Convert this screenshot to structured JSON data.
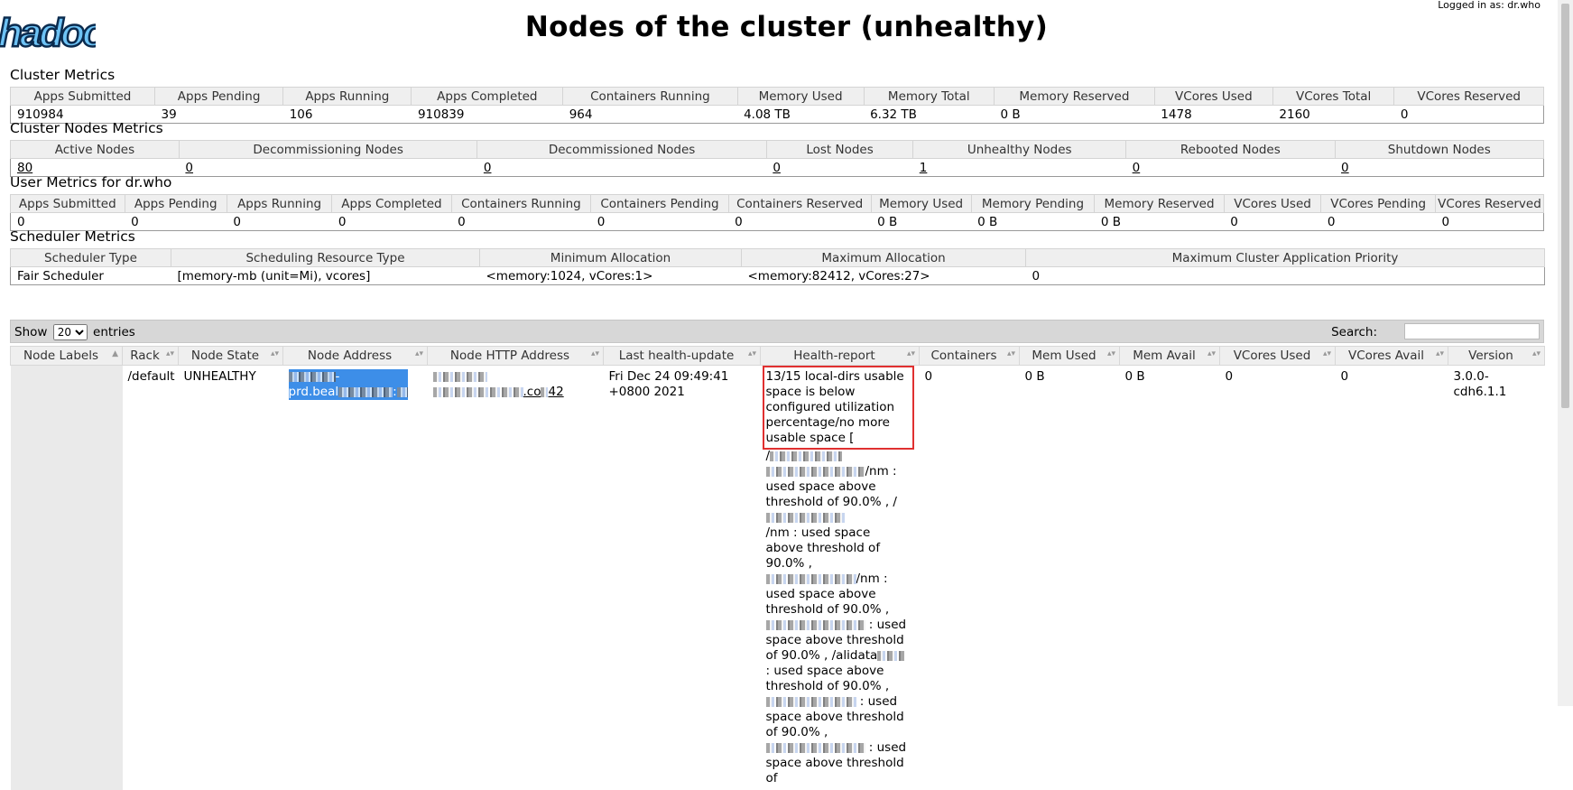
{
  "header": {
    "logo": "hadoop",
    "title": "Nodes of the cluster (unhealthy)",
    "logged_in": "Logged in as: dr.who"
  },
  "cluster_metrics": {
    "title": "Cluster Metrics",
    "headers": [
      "Apps Submitted",
      "Apps Pending",
      "Apps Running",
      "Apps Completed",
      "Containers Running",
      "Memory Used",
      "Memory Total",
      "Memory Reserved",
      "VCores Used",
      "VCores Total",
      "VCores Reserved"
    ],
    "values": [
      "910984",
      "39",
      "106",
      "910839",
      "964",
      "4.08 TB",
      "6.32 TB",
      "0 B",
      "1478",
      "2160",
      "0"
    ]
  },
  "cluster_nodes_metrics": {
    "title": "Cluster Nodes Metrics",
    "headers": [
      "Active Nodes",
      "Decommissioning Nodes",
      "Decommissioned Nodes",
      "Lost Nodes",
      "Unhealthy Nodes",
      "Rebooted Nodes",
      "Shutdown Nodes"
    ],
    "values": [
      "80",
      "0",
      "0",
      "0",
      "1",
      "0",
      "0"
    ]
  },
  "user_metrics": {
    "title": "User Metrics for dr.who",
    "headers": [
      "Apps Submitted",
      "Apps Pending",
      "Apps Running",
      "Apps Completed",
      "Containers Running",
      "Containers Pending",
      "Containers Reserved",
      "Memory Used",
      "Memory Pending",
      "Memory Reserved",
      "VCores Used",
      "VCores Pending",
      "VCores Reserved"
    ],
    "values": [
      "0",
      "0",
      "0",
      "0",
      "0",
      "0",
      "0",
      "0 B",
      "0 B",
      "0 B",
      "0",
      "0",
      "0"
    ]
  },
  "scheduler_metrics": {
    "title": "Scheduler Metrics",
    "headers": [
      "Scheduler Type",
      "Scheduling Resource Type",
      "Minimum Allocation",
      "Maximum Allocation",
      "Maximum Cluster Application Priority"
    ],
    "values": [
      "Fair Scheduler",
      "[memory-mb (unit=Mi), vcores]",
      "<memory:1024, vCores:1>",
      "<memory:82412, vCores:27>",
      "0"
    ]
  },
  "table_controls": {
    "show_label": "Show",
    "entries_option": "20",
    "entries_label": "entries",
    "search_label": "Search:",
    "search_value": ""
  },
  "nodes_table": {
    "headers": [
      "Node Labels",
      "Rack",
      "Node State",
      "Node Address",
      "Node HTTP Address",
      "Last health-update",
      "Health-report",
      "Containers",
      "Mem Used",
      "Mem Avail",
      "VCores Used",
      "VCores Avail",
      "Version"
    ],
    "row": {
      "node_labels": "",
      "rack": "/default",
      "node_state": "UNHEALTHY",
      "node_address_visible": [
        "-",
        "prd.beal",
        ":"
      ],
      "node_http_address_visible": [
        ".co",
        "42"
      ],
      "last_health_update": "Fri Dec 24 09:49:41 +0800 2021",
      "health_report_highlighted": "13/15 local-dirs usable space is below configured utilization percentage/no more usable space [",
      "health_report_rest": [
        "/",
        "/nm : used space above threshold of 90.0% , /",
        "/nm : used space above threshold of 90.0% ,",
        "/nm : used space above threshold of 90.0% ,",
        " : used space above threshold of 90.0% , /alidata",
        " : used space above threshold of 90.0% ,",
        " : used space above threshold of 90.0% ,",
        " : used space above threshold of"
      ],
      "containers": "0",
      "mem_used": "0 B",
      "mem_avail": "0 B",
      "vcores_used": "0",
      "vcores_avail": "0",
      "version": "3.0.0-cdh6.1.1"
    }
  },
  "colors": {
    "header_bg": "#efefef",
    "controls_bg": "#d7d7d7",
    "highlight_box": "#e03030",
    "selection": "#3d8ee8"
  }
}
